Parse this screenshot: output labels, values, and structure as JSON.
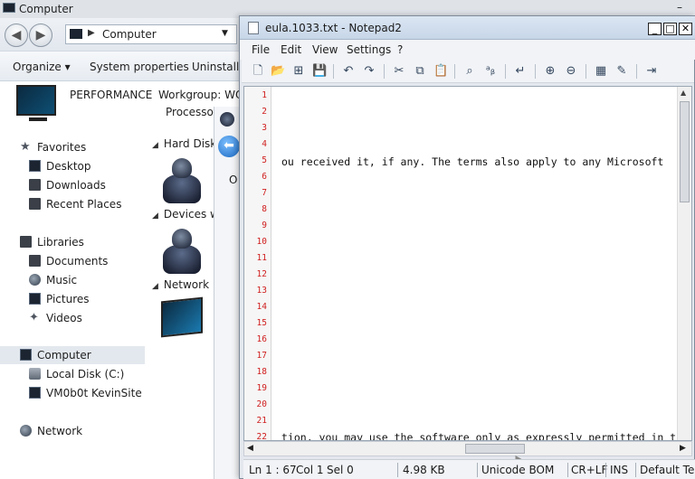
{
  "explorer": {
    "title": "Computer",
    "address": "Computer",
    "toolbar": {
      "organize": "Organize ▾",
      "system_properties": "System properties",
      "uninstall": "Uninstall"
    },
    "info": {
      "computer_name": "PERFORMANCE",
      "workgroup": "Workgroup: WO",
      "processor": "Processo"
    },
    "nav": {
      "favorites": "Favorites",
      "desktop": "Desktop",
      "downloads": "Downloads",
      "recent_places": "Recent Places",
      "libraries": "Libraries",
      "documents": "Documents",
      "music": "Music",
      "pictures": "Pictures",
      "videos": "Videos",
      "computer": "Computer",
      "local_disk": "Local Disk (C:)",
      "vm_share": "VM0b0t KevinSite",
      "network": "Network"
    },
    "groups": {
      "hard_disks": "Hard Disk",
      "devices": "Devices w",
      "network": "Network"
    },
    "mid_letter": "O"
  },
  "notepad": {
    "title": "eula.1033.txt - Notepad2",
    "menu": [
      "File",
      "Edit",
      "View",
      "Settings",
      "?"
    ],
    "line_numbers": [
      "1",
      "2",
      "3",
      "4",
      "5",
      "6",
      "7",
      "8",
      "9",
      "10",
      "11",
      "12",
      "13",
      "14",
      "15",
      "16",
      "17",
      "18",
      "19",
      "20",
      "21",
      "22"
    ],
    "line5": "ou received it, if any.  The terms also apply to any Microsoft",
    "line22": "tion, you may use the software only as expressly permitted in th",
    "status": {
      "position": "Ln 1 : 67",
      "column": "Col 1",
      "selection": "Sel 0",
      "size": "4.98 KB",
      "encoding": "Unicode BOM",
      "eol": "CR+LF",
      "mode": "INS",
      "scheme": "Default Te"
    }
  }
}
